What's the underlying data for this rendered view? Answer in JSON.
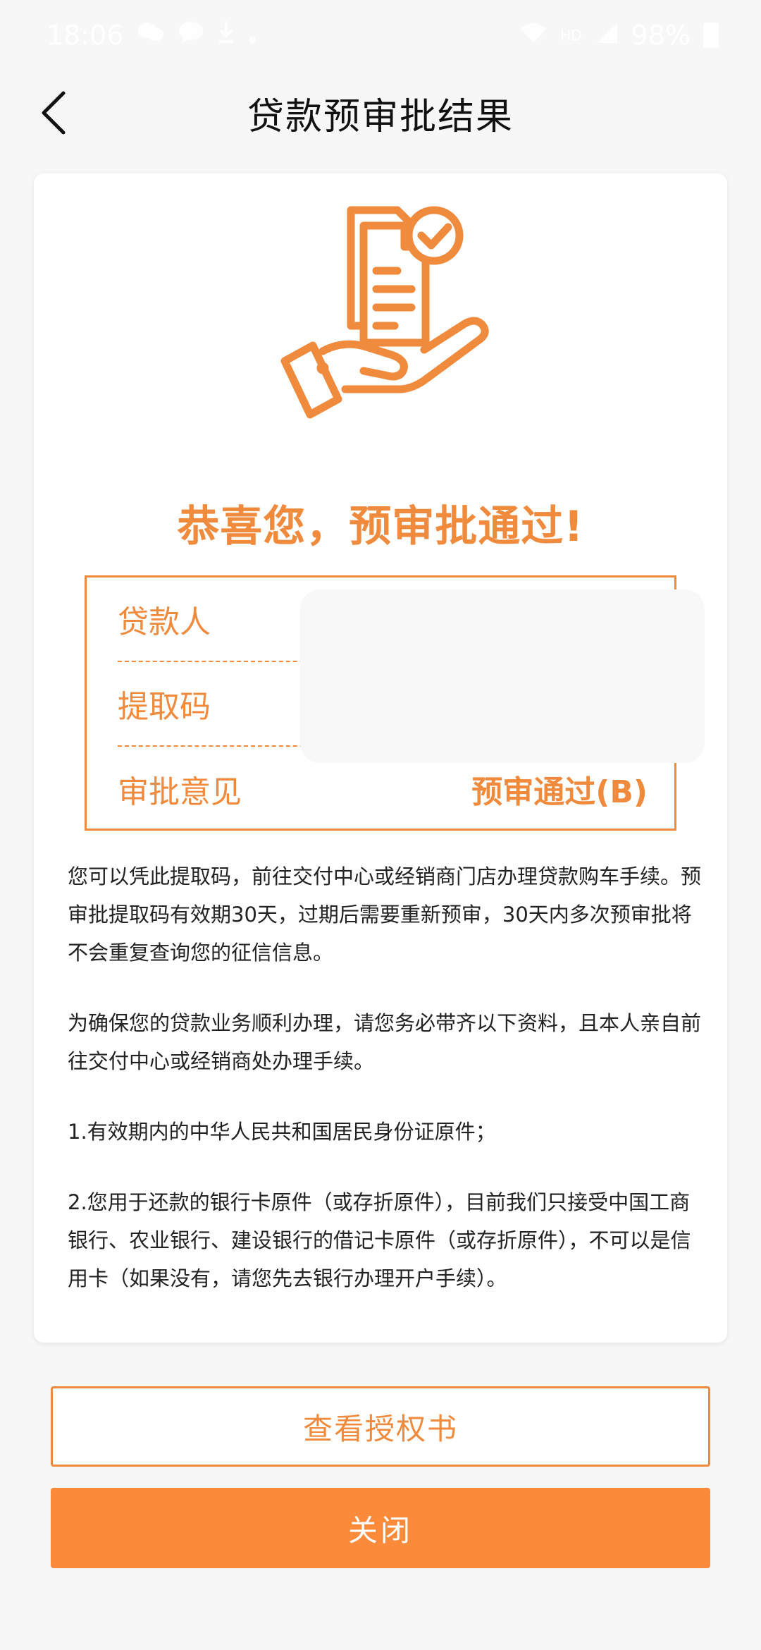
{
  "status_bar": {
    "time": "18:06",
    "battery": "98%",
    "network": "HD"
  },
  "nav": {
    "title": "贷款预审批结果"
  },
  "result": {
    "headline": "恭喜您，预审批通过!",
    "rows": [
      {
        "label": "贷款人",
        "value": ""
      },
      {
        "label": "提取码",
        "value": ""
      },
      {
        "label": "审批意见",
        "value": "预审通过(B)"
      }
    ]
  },
  "description": {
    "paragraphs": [
      "您可以凭此提取码，前往交付中心或经销商门店办理贷款购车手续。预审批提取码有效期30天，过期后需要重新预审，30天内多次预审批将不会重复查询您的征信信息。",
      "为确保您的贷款业务顺利办理，请您务必带齐以下资料，且本人亲自前往交付中心或经销商处办理手续。",
      "1.有效期内的中华人民共和国居民身份证原件；",
      "2.您用于还款的银行卡原件（或存折原件），目前我们只接受中国工商银行、农业银行、建设银行的借记卡原件（或存折原件），不可以是信用卡（如果没有，请您先去银行办理开户手续）。"
    ]
  },
  "buttons": {
    "view_authorization": "查看授权书",
    "close": "关闭"
  },
  "colors": {
    "accent": "#f08a3c",
    "primary_button": "#fb8a3a",
    "background": "#f7f7f7"
  },
  "icons": {
    "back": "chevron-left-icon",
    "illustration": "hand-holding-approved-document-icon"
  }
}
